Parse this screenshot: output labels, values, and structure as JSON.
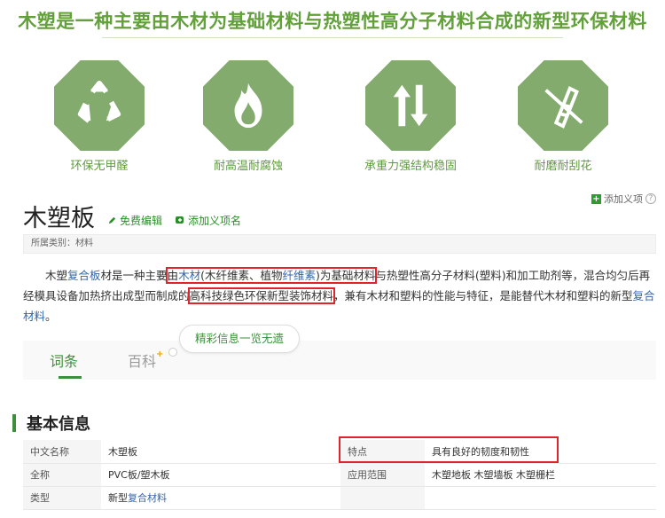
{
  "banner": {
    "title": "木塑是一种主要由木材为基础材料与热塑性高分子材料合成的新型环保材料",
    "features": [
      {
        "icon": "recycle-icon",
        "label": "环保无甲醛"
      },
      {
        "icon": "flame-icon",
        "label": "耐高温耐腐蚀"
      },
      {
        "icon": "up-down-arrows-icon",
        "label": "承重力强结构稳固"
      },
      {
        "icon": "no-scratch-icon",
        "label": "耐磨耐刮花"
      }
    ],
    "colors": {
      "accent": "#82ab6d",
      "text": "#62a03a"
    }
  },
  "toolbar": {
    "add_item_label": "添加义项",
    "help_label": "?"
  },
  "entry": {
    "title": "木塑板",
    "edit_label": "免费编辑",
    "add_item_label": "添加义项名",
    "category_text": "所属类别：材料"
  },
  "summary": {
    "t1": "木塑",
    "link1": "复合板",
    "t2": "材是一种主要",
    "hl1_a": "由",
    "hl1_link1": "木材",
    "hl1_b": "(木纤维素、植物",
    "hl1_link2": "纤维素",
    "hl1_c": ")为基础材料",
    "t3": "与热塑性高分子材料(塑料)和加工助剂等，混合均匀后再经模具设备加热挤出成型而制成的",
    "hl2": "高科技绿色环保新型装饰材料",
    "t4": "，兼有木材和塑料的性能与特征，是能替代木材和塑料的新型",
    "link3": "复合材料",
    "t5": "。"
  },
  "tabs": [
    {
      "label": "词条"
    },
    {
      "label": "百科"
    }
  ],
  "bubble_text": "精彩信息一览无遗",
  "basic_info": {
    "heading": "基本信息",
    "rows": [
      {
        "k1": "中文名称",
        "v1": "木塑板",
        "k2": "特点",
        "v2": "具有良好的韧度和韧性"
      },
      {
        "k1": "全称",
        "v1": "PVC板/塑木板",
        "k2": "应用范围",
        "v2": "木塑地板 木塑墙板 木塑栅栏"
      },
      {
        "k1": "类型",
        "v1_pre": "新型",
        "v1_link": "复合材料",
        "k2": "",
        "v2": ""
      }
    ]
  }
}
